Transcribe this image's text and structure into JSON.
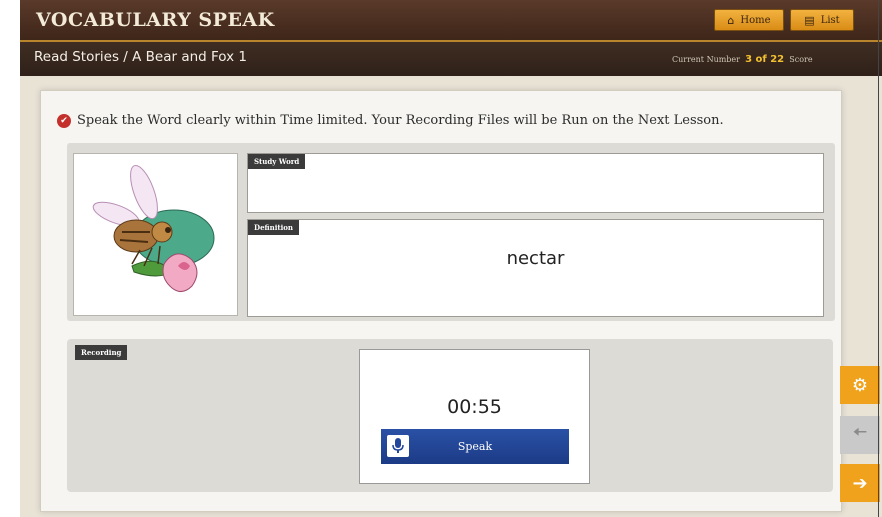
{
  "header": {
    "app_title": "VOCABULARY SPEAK",
    "home_label": "Home",
    "home_icon": "home-icon",
    "list_label": "List",
    "list_icon": "list-icon"
  },
  "subheader": {
    "breadcrumb": "Read Stories / A Bear and Fox 1",
    "counter_label": "Current Number",
    "counter_value": "3 of 22",
    "score_label": "Score"
  },
  "content": {
    "instruction": "Speak the Word clearly within Time limited. Your Recording Files will be Run on the Next Lesson.",
    "study_word_tag": "Study Word",
    "study_word": "",
    "definition_tag": "Definition",
    "definition": "nectar",
    "image_subject": "bee-on-flower-illustration"
  },
  "recording": {
    "tag": "Recording",
    "timer": "00:55",
    "speak_label": "Speak",
    "mic_icon": "microphone-icon"
  },
  "side_buttons": {
    "settings_icon": "gear-icon",
    "back_icon": "arrow-left-icon",
    "next_icon": "arrow-right-icon"
  },
  "colors": {
    "header_brown": "#4a2f20",
    "accent_orange": "#f0a21c",
    "speak_blue": "#23479b",
    "counter_yellow": "#f2c031"
  }
}
